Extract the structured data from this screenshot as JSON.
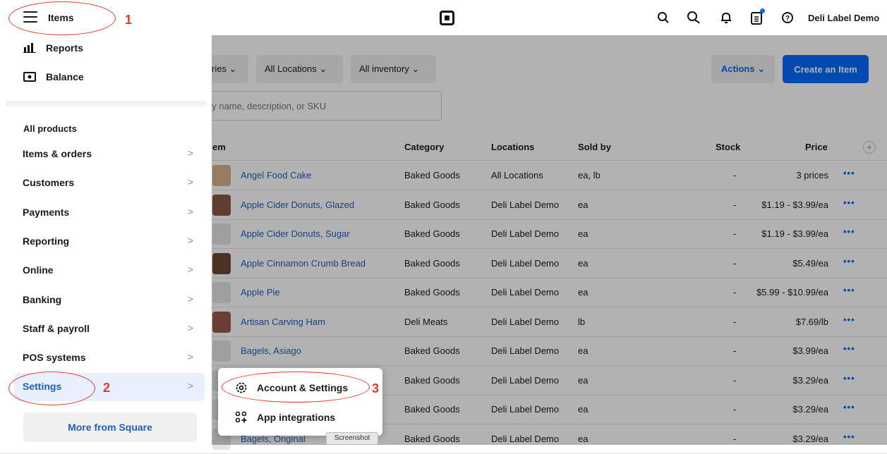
{
  "header": {
    "title": "Items",
    "account_name": "Deli Label Demo",
    "icons": [
      "search-icon",
      "messages-icon",
      "bell-icon",
      "clipboard-icon",
      "help-icon"
    ]
  },
  "toolbar": {
    "filter_categories": "ries ⌄",
    "filter_locations": "All Locations ⌄",
    "filter_inventory": "All inventory ⌄",
    "actions_label": "Actions ⌄",
    "create_label": "Create an Item",
    "search_placeholder": "by name, description, or SKU"
  },
  "table": {
    "columns": [
      "em",
      "Category",
      "Locations",
      "Sold by",
      "Stock",
      "Price"
    ],
    "rows": [
      {
        "name": "Angel Food Cake",
        "category": "Baked Goods",
        "locations": "All Locations",
        "sold_by": "ea, lb",
        "stock": "-",
        "price": "3 prices",
        "thumb": "#d9b48a"
      },
      {
        "name": "Apple Cider Donuts, Glazed",
        "category": "Baked Goods",
        "locations": "Deli Label Demo",
        "sold_by": "ea",
        "stock": "-",
        "price": "$1.19 - $3.99/ea",
        "thumb": "#8a5a44"
      },
      {
        "name": "Apple Cider Donuts, Sugar",
        "category": "Baked Goods",
        "locations": "Deli Label Demo",
        "sold_by": "ea",
        "stock": "-",
        "price": "$1.19 - $3.99/ea",
        "thumb": "#e4e4e4"
      },
      {
        "name": "Apple Cinnamon Crumb Bread",
        "category": "Baked Goods",
        "locations": "Deli Label Demo",
        "sold_by": "ea",
        "stock": "-",
        "price": "$5.49/ea",
        "thumb": "#6b4a36"
      },
      {
        "name": "Apple Pie",
        "category": "Baked Goods",
        "locations": "Deli Label Demo",
        "sold_by": "ea",
        "stock": "-",
        "price": "$5.99 - $10.99/ea",
        "thumb": "#e4e4e4"
      },
      {
        "name": "Artisan Carving Ham",
        "category": "Deli Meats",
        "locations": "Deli Label Demo",
        "sold_by": "lb",
        "stock": "-",
        "price": "$7.69/lb",
        "thumb": "#9a5a4a"
      },
      {
        "name": "Bagels, Asiago",
        "category": "Baked Goods",
        "locations": "Deli Label Demo",
        "sold_by": "ea",
        "stock": "-",
        "price": "$3.99/ea",
        "thumb": "#e4e4e4"
      },
      {
        "name": "",
        "category": "Baked Goods",
        "locations": "Deli Label Demo",
        "sold_by": "ea",
        "stock": "-",
        "price": "$3.29/ea",
        "thumb": "#e4e4e4"
      },
      {
        "name": "",
        "category": "Baked Goods",
        "locations": "Deli Label Demo",
        "sold_by": "ea",
        "stock": "-",
        "price": "$3.29/ea",
        "thumb": "#e4e4e4"
      },
      {
        "name": "Bagels, Original",
        "category": "Baked Goods",
        "locations": "Deli Label Demo",
        "sold_by": "ea",
        "stock": "-",
        "price": "$3.29/ea",
        "thumb": "#e4e4e4"
      }
    ],
    "row_menu": "•••",
    "add_column": "+"
  },
  "sidebar": {
    "top_items": [
      {
        "label": "Reports",
        "icon": "reports-icon"
      },
      {
        "label": "Balance",
        "icon": "balance-icon"
      }
    ],
    "section_heading": "All products",
    "items": [
      {
        "label": "Items & orders"
      },
      {
        "label": "Customers"
      },
      {
        "label": "Payments"
      },
      {
        "label": "Reporting"
      },
      {
        "label": "Online"
      },
      {
        "label": "Banking"
      },
      {
        "label": "Staff & payroll"
      },
      {
        "label": "POS systems"
      },
      {
        "label": "Settings"
      }
    ],
    "chevron": ">",
    "more_label": "More from Square"
  },
  "popup": {
    "items": [
      {
        "label": "Account & Settings",
        "icon": "gear-icon"
      },
      {
        "label": "App integrations",
        "icon": "app-integrations-icon"
      }
    ],
    "tooltip": "Screenshot"
  },
  "annotations": [
    "1",
    "2",
    "3"
  ],
  "colors": {
    "accent": "#006aff",
    "annotation": "#e8362b",
    "link": "#1f5fbf"
  }
}
